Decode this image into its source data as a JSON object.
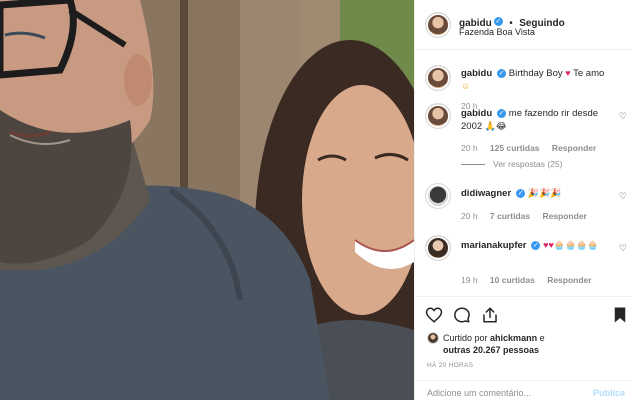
{
  "header": {
    "username": "gabidu",
    "separator": "•",
    "follow_status": "Seguindo",
    "location": "Fazenda Boa Vista"
  },
  "caption": {
    "username": "gabidu",
    "text": "Birthday Boy",
    "emoji1": "♥",
    "text2": "Te amo",
    "emoji2": "☺",
    "time": "20 h"
  },
  "comments": [
    {
      "username": "gabidu",
      "text": "me fazendo rir desde 2002",
      "emoji": "🙏😂",
      "time": "20 h",
      "likes": "125 curtidas",
      "reply": "Responder",
      "view_replies": "Ver respostas (25)"
    },
    {
      "username": "didiwagner",
      "text": "",
      "emoji": "🎉🎉🎉",
      "time": "20 h",
      "likes": "7 curtidas",
      "reply": "Responder"
    },
    {
      "username": "marianakupfer",
      "text": "",
      "emoji": "♥♥🧁🧁🧁🧁",
      "time": "19 h",
      "likes": "10 curtidas",
      "reply": "Responder"
    }
  ],
  "likes": {
    "prefix": "Curtido por",
    "first_user": "ahickmann",
    "and": "e",
    "others": "outras 20.267 pessoas"
  },
  "posted_ago": "HÁ 20 HORAS",
  "add_comment": {
    "placeholder": "Adicione um comentário...",
    "publish": "Publica"
  },
  "icons": {
    "verified": "verified-badge-icon",
    "like": "heart-icon",
    "comment": "comment-icon",
    "share": "share-icon",
    "save": "bookmark-icon"
  }
}
